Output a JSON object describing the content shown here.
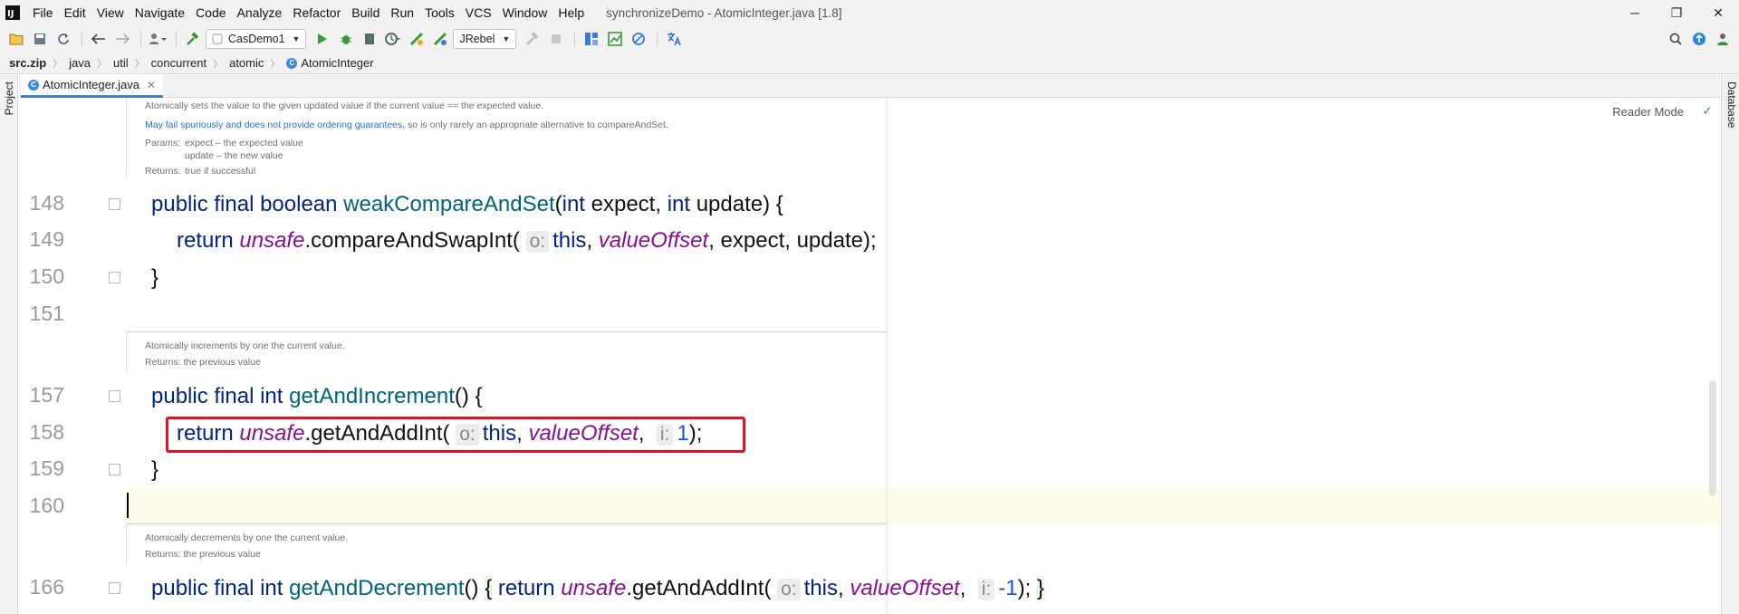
{
  "window": {
    "title": "synchronizeDemo - AtomicInteger.java [1.8]",
    "logo": "IJ",
    "minimize": "─",
    "restore": "❐",
    "close": "✕"
  },
  "menu": [
    "File",
    "Edit",
    "View",
    "Navigate",
    "Code",
    "Analyze",
    "Refactor",
    "Build",
    "Run",
    "Tools",
    "VCS",
    "Window",
    "Help"
  ],
  "toolbar": {
    "run_config": "CasDemo1",
    "jrebel": "JRebel"
  },
  "breadcrumb": [
    "src.zip",
    "java",
    "util",
    "concurrent",
    "atomic",
    "AtomicInteger"
  ],
  "side": {
    "left_panel": "Project",
    "right_panel": "Database"
  },
  "tab": {
    "label": "AtomicInteger.java",
    "close": "✕"
  },
  "editor": {
    "reader_mode": "Reader Mode",
    "doc1": {
      "line1": "Atomically sets the value to the given updated value if the current value == the expected value.",
      "line2_link": "May fail spuriously and does not provide ordering guarantees",
      "line2_rest": ", so is only rarely an appropriate alternative to compareAndSet.",
      "params_label": "Params:",
      "param1": "expect – the expected value",
      "param2": "update – the new value",
      "returns_label": "Returns:",
      "returns": "true if successful"
    },
    "doc2": {
      "line1": "Atomically increments by one the current value.",
      "returns": "Returns: the previous value"
    },
    "doc3": {
      "line1": "Atomically decrements by one the current value.",
      "returns": "Returns: the previous value"
    },
    "line_numbers": [
      "148",
      "149",
      "150",
      "151",
      "157",
      "158",
      "159",
      "160",
      "166"
    ]
  }
}
